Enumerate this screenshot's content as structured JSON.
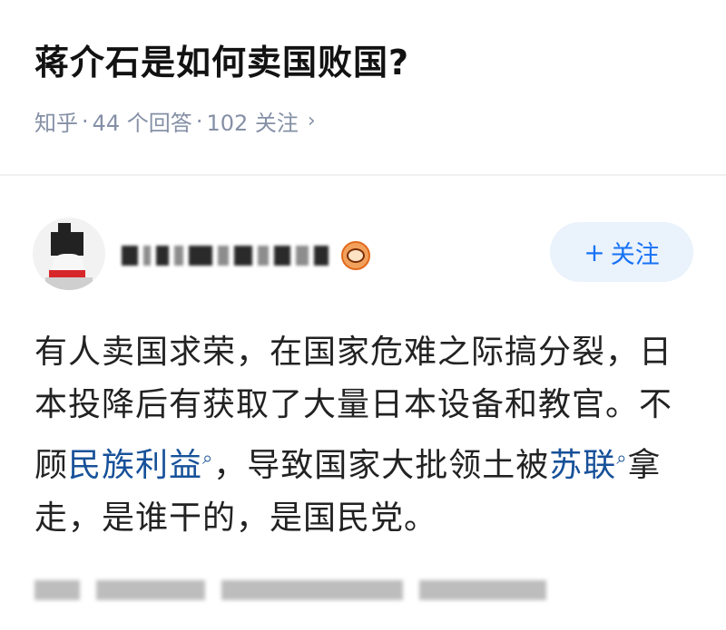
{
  "question": {
    "title": "蒋介石是如何卖国败国?",
    "source": "知乎",
    "answers": "44 个回答",
    "followers": "102 关注",
    "separator": "·"
  },
  "author": {
    "follow_label": "关注",
    "follow_prefix": "+"
  },
  "answer": {
    "part1": "有人卖国求荣，在国家危难之际搞分裂，日本投降后有获取了大量日本设备和教官。不顾",
    "link1": "民族利益",
    "part2": "，导致国家大批领土被",
    "link2": "苏联",
    "part3": "拿走，是谁干的，是国民党。"
  },
  "icons": {
    "chevron": "chevron-right-icon",
    "search_link": "search-link-icon",
    "badge": "vip-badge-icon"
  },
  "colors": {
    "accent": "#1772f6",
    "link": "#175199",
    "meta": "#8590a6"
  }
}
